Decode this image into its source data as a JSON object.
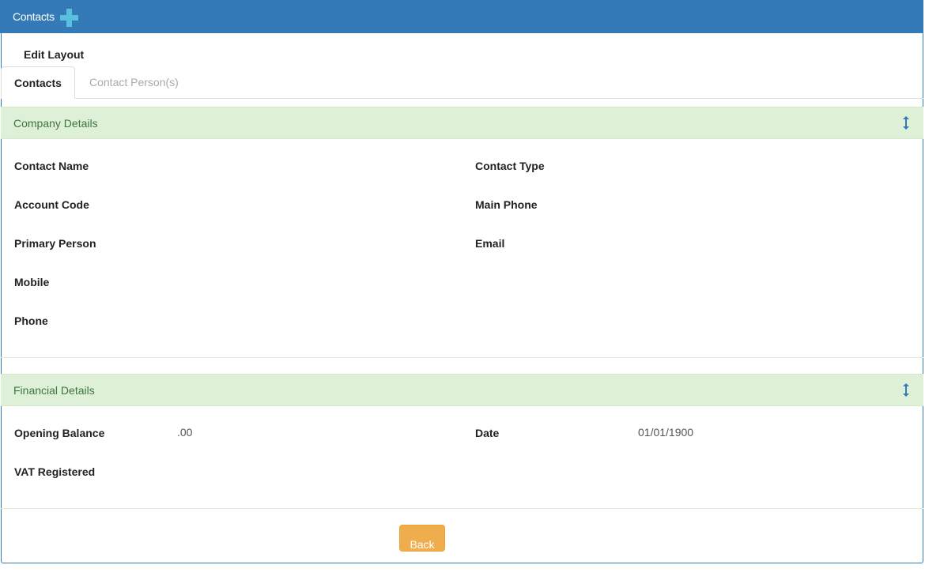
{
  "header": {
    "title": "Contacts",
    "add_icon": "plus-icon",
    "bg_color": "#337ab7"
  },
  "edit_layout": "Edit Layout",
  "tabs": [
    {
      "label": "Contacts",
      "active": true
    },
    {
      "label": "Contact Person(s)",
      "active": false
    }
  ],
  "company_details": {
    "title": "Company Details",
    "toggle_icon": "resize-vertical-icon",
    "left_fields": [
      {
        "label": "Contact Name",
        "value": ""
      },
      {
        "label": "Account Code",
        "value": ""
      },
      {
        "label": "Primary Person",
        "value": ""
      },
      {
        "label": "Mobile",
        "value": ""
      },
      {
        "label": "Phone",
        "value": ""
      }
    ],
    "right_fields": [
      {
        "label": "Contact Type",
        "value": ""
      },
      {
        "label": "Main Phone",
        "value": ""
      },
      {
        "label": "Email",
        "value": ""
      }
    ]
  },
  "financial_details": {
    "title": "Financial Details",
    "toggle_icon": "resize-vertical-icon",
    "left_fields": [
      {
        "label": "Opening Balance",
        "value": ".00"
      },
      {
        "label": "VAT Registered",
        "value": ""
      }
    ],
    "right_fields": [
      {
        "label": "Date",
        "value": "01/01/1900"
      }
    ]
  },
  "actions": {
    "back_label": "Back",
    "back_color": "#f0ad4e"
  }
}
